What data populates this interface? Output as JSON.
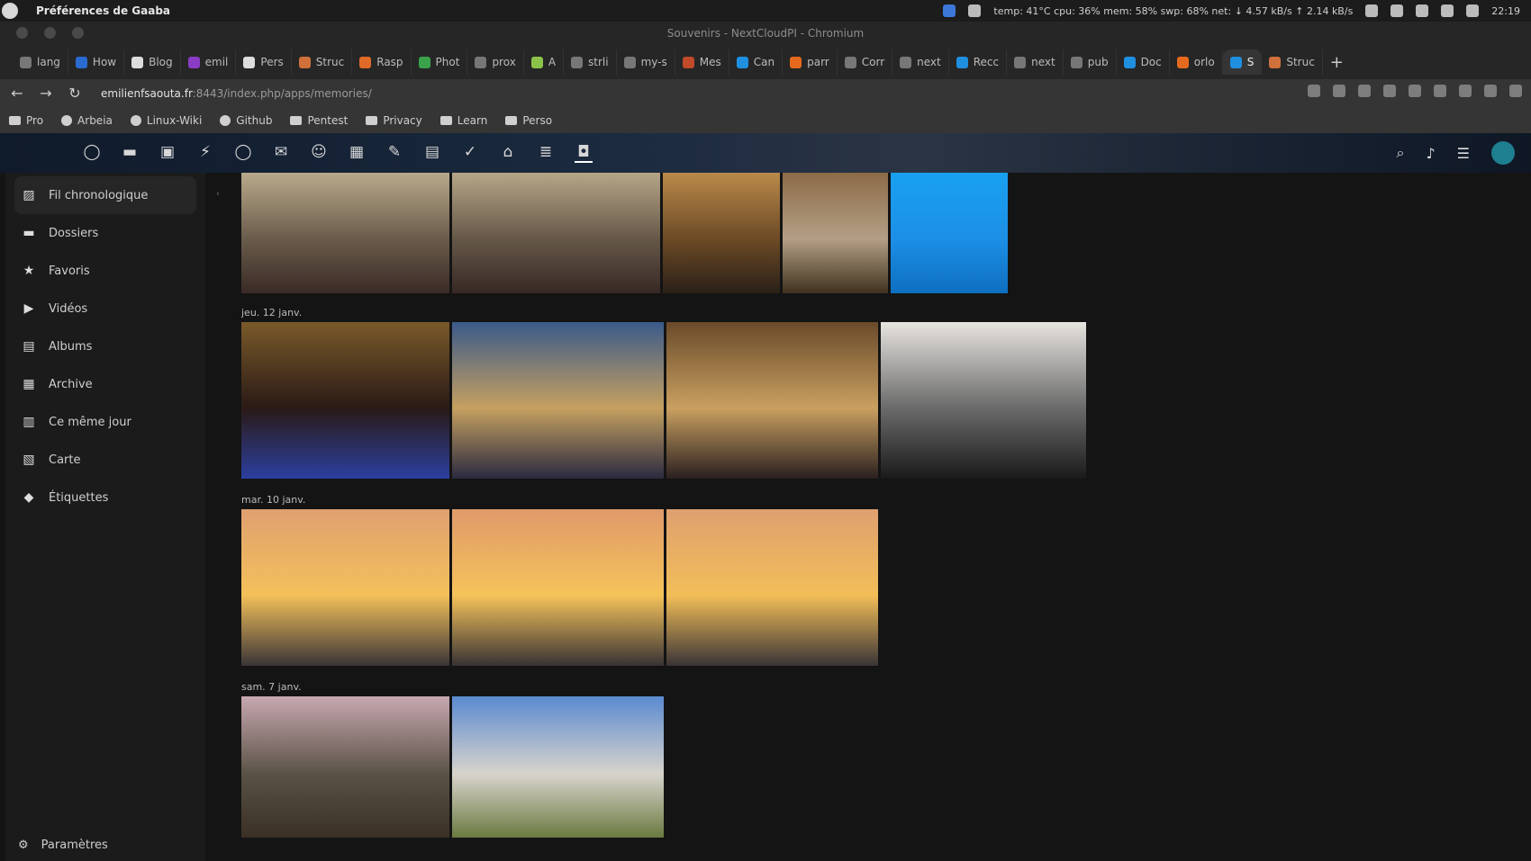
{
  "system_bar": {
    "app_name": "Préférences de Gaaba",
    "status": "temp: 41°C cpu: 36% mem: 58% swp: 68% net: ↓ 4.57 kB/s ↑ 2.14 kB/s",
    "time": "22:19"
  },
  "window": {
    "title": "Souvenirs - NextCloudPI - Chromium"
  },
  "tabs": [
    {
      "label": "lang",
      "color": "#777"
    },
    {
      "label": "How",
      "color": "#2a6bd1"
    },
    {
      "label": "Blog",
      "color": "#ddd"
    },
    {
      "label": "emil",
      "color": "#8a3cc5"
    },
    {
      "label": "Pers",
      "color": "#ddd"
    },
    {
      "label": "Struc",
      "color": "#d0703a"
    },
    {
      "label": "Rasp",
      "color": "#e06a28"
    },
    {
      "label": "Phot",
      "color": "#3aa24b"
    },
    {
      "label": "prox",
      "color": "#777"
    },
    {
      "label": "A",
      "color": "#8bc34a"
    },
    {
      "label": "strli",
      "color": "#777"
    },
    {
      "label": "my-s",
      "color": "#777"
    },
    {
      "label": "Mes",
      "color": "#c04a2a"
    },
    {
      "label": "Can",
      "color": "#1f8fe0"
    },
    {
      "label": "parr",
      "color": "#e66a1d"
    },
    {
      "label": "Corr",
      "color": "#777"
    },
    {
      "label": "next",
      "color": "#777"
    },
    {
      "label": "Recc",
      "color": "#1f8fe0"
    },
    {
      "label": "next",
      "color": "#777"
    },
    {
      "label": "pub",
      "color": "#777"
    },
    {
      "label": "Doc",
      "color": "#1f8fe0"
    },
    {
      "label": "orlo",
      "color": "#e66a1d"
    },
    {
      "label": "S",
      "color": "#1f8fe0",
      "active": true
    },
    {
      "label": "Struc",
      "color": "#d0703a"
    }
  ],
  "address": {
    "domain": "emilienfsaouta.fr",
    "path": ":8443/index.php/apps/memories/"
  },
  "bookmarks": [
    {
      "label": "Pro",
      "icon": "folder-icon"
    },
    {
      "label": "Arbeia",
      "icon": "globe-icon"
    },
    {
      "label": "Linux-Wiki",
      "icon": "globe-icon"
    },
    {
      "label": "Github",
      "icon": "github-icon"
    },
    {
      "label": "Pentest",
      "icon": "folder-icon"
    },
    {
      "label": "Privacy",
      "icon": "folder-icon"
    },
    {
      "label": "Learn",
      "icon": "folder-icon"
    },
    {
      "label": "Perso",
      "icon": "folder-icon"
    }
  ],
  "nc_apps": [
    {
      "name": "dashboard-icon",
      "glyph": "◯"
    },
    {
      "name": "files-icon",
      "glyph": "▬"
    },
    {
      "name": "photos-icon",
      "glyph": "▣"
    },
    {
      "name": "activity-icon",
      "glyph": "⚡"
    },
    {
      "name": "circle-icon",
      "glyph": "◯"
    },
    {
      "name": "mail-icon",
      "glyph": "✉"
    },
    {
      "name": "contacts-icon",
      "glyph": "☺"
    },
    {
      "name": "calendar-icon",
      "glyph": "▦"
    },
    {
      "name": "notes-icon",
      "glyph": "✎"
    },
    {
      "name": "deck-icon",
      "glyph": "▤"
    },
    {
      "name": "tasks-icon",
      "glyph": "✓"
    },
    {
      "name": "maps-icon",
      "glyph": "⌂"
    },
    {
      "name": "forms-icon",
      "glyph": "≣"
    },
    {
      "name": "memories-icon",
      "glyph": "◘",
      "active": true
    }
  ],
  "nc_right_icons": [
    "search-icon",
    "bell-icon",
    "contacts-menu-icon",
    "avatar"
  ],
  "sidebar": {
    "items": [
      {
        "label": "Fil chronologique",
        "icon": "timeline-icon",
        "glyph": "▨",
        "active": true
      },
      {
        "label": "Dossiers",
        "icon": "folder-icon",
        "glyph": "▬"
      },
      {
        "label": "Favoris",
        "icon": "star-icon",
        "glyph": "★"
      },
      {
        "label": "Vidéos",
        "icon": "video-icon",
        "glyph": "▶"
      },
      {
        "label": "Albums",
        "icon": "album-icon",
        "glyph": "▤"
      },
      {
        "label": "Archive",
        "icon": "archive-icon",
        "glyph": "▦"
      },
      {
        "label": "Ce même jour",
        "icon": "calendar-icon",
        "glyph": "▥"
      },
      {
        "label": "Carte",
        "icon": "map-icon",
        "glyph": "▧"
      },
      {
        "label": "Étiquettes",
        "icon": "tag-icon",
        "glyph": "◆"
      }
    ],
    "settings_label": "Paramètres"
  },
  "timeline": [
    {
      "label": "",
      "photos": [
        {
          "w": 231,
          "colors": [
            "#b9a98b",
            "#6a5c4b",
            "#3a2a26"
          ]
        },
        {
          "w": 231,
          "colors": [
            "#b6a688",
            "#665848",
            "#372824"
          ]
        },
        {
          "w": 130,
          "colors": [
            "#b98a4a",
            "#6d4a26",
            "#2a2018"
          ]
        },
        {
          "w": 117,
          "colors": [
            "#8c6b47",
            "#b39f85",
            "#40321f"
          ]
        },
        {
          "w": 130,
          "colors": [
            "#19a0f0",
            "#1c8fe6",
            "#0e6fc0"
          ]
        }
      ],
      "h": 134
    },
    {
      "label": "jeu. 12 janv.",
      "photos": [
        {
          "w": 231,
          "colors": [
            "#7a5a2a",
            "#2a1a16",
            "#2c3fa0"
          ]
        },
        {
          "w": 235,
          "colors": [
            "#3a5a8a",
            "#c6a060",
            "#2a2a40"
          ]
        },
        {
          "w": 235,
          "colors": [
            "#6a4a2a",
            "#c9a060",
            "#2a2020"
          ]
        },
        {
          "w": 228,
          "colors": [
            "#e8e4e0",
            "#6a6a6a",
            "#1a1a1a"
          ]
        }
      ],
      "h": 174
    },
    {
      "label": "mar. 10 janv.",
      "photos": [
        {
          "w": 231,
          "colors": [
            "#e0a070",
            "#f3c05a",
            "#3a3436"
          ]
        },
        {
          "w": 235,
          "colors": [
            "#e09a6a",
            "#f5c35a",
            "#383234"
          ]
        },
        {
          "w": 235,
          "colors": [
            "#dea070",
            "#f2be58",
            "#3a3436"
          ]
        }
      ],
      "h": 174
    },
    {
      "label": "sam. 7 janv.",
      "photos": [
        {
          "w": 231,
          "colors": [
            "#c8a8b0",
            "#5a5246",
            "#3a3026"
          ]
        },
        {
          "w": 235,
          "colors": [
            "#5a8ad0",
            "#d8d4cc",
            "#6a7a40"
          ]
        }
      ],
      "h": 157
    }
  ]
}
